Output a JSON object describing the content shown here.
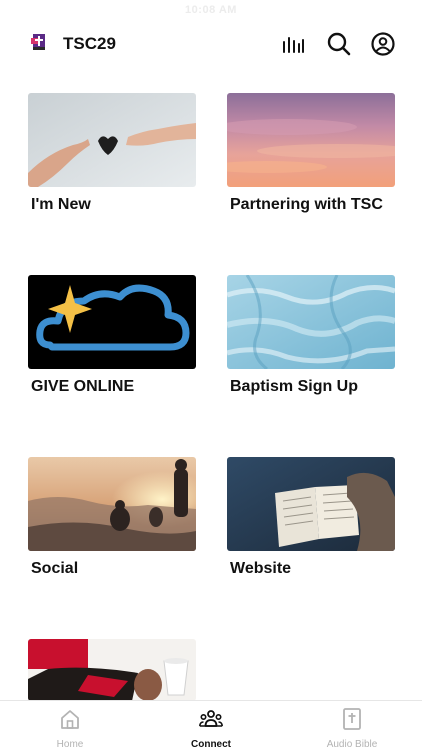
{
  "status_bar": {
    "time": "10:08 AM"
  },
  "header": {
    "title": "TSC29",
    "icons": [
      "logo-icon",
      "audio-bars-icon",
      "search-icon",
      "profile-icon"
    ]
  },
  "cards": [
    {
      "label": "I'm New",
      "image": "hands-heart"
    },
    {
      "label": "Partnering with TSC",
      "image": "pink-sunset-clouds"
    },
    {
      "label": "GIVE ONLINE",
      "image": "cloud-star-logo"
    },
    {
      "label": "Baptism Sign Up",
      "image": "aerial-water"
    },
    {
      "label": "Social",
      "image": "sunset-mountain-people"
    },
    {
      "label": "Website",
      "image": "open-bible"
    },
    {
      "label": "",
      "image": "table-cup"
    }
  ],
  "tabbar": {
    "tabs": [
      {
        "label": "Home",
        "icon": "home-icon",
        "active": false
      },
      {
        "label": "Connect",
        "icon": "group-icon",
        "active": true
      },
      {
        "label": "Audio Bible",
        "icon": "bible-icon",
        "active": false
      }
    ]
  },
  "colors": {
    "accent": "#111111",
    "inactive": "#b3b3b3",
    "cloud_blue": "#3d8fd1",
    "star_gold": "#f4c046"
  }
}
